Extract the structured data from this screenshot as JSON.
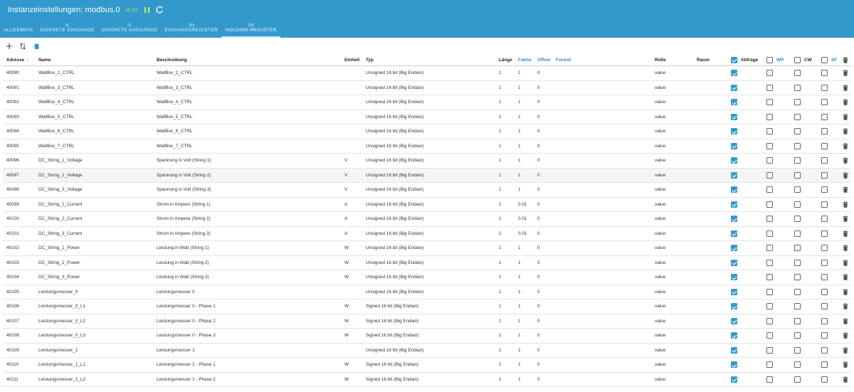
{
  "header": {
    "title": "Instanzeinstellungen: modbus.0",
    "version": "v5.3.5",
    "status_color": "#b6f06a",
    "accent": "#3399cc"
  },
  "tabs": [
    {
      "count": "",
      "label": "ALLGEMEIN",
      "active": false
    },
    {
      "count": "01",
      "label": "DISKRETE EINGÄNGE",
      "active": false
    },
    {
      "count": "01",
      "label": "DISKRETE AUSGÄNGE",
      "active": false
    },
    {
      "count": "193",
      "label": "EINGANGSREGISTER",
      "active": false
    },
    {
      "count": "193",
      "label": "HOLDING-REGISTER",
      "active": true
    }
  ],
  "toolbar": {
    "icons": [
      "plus-icon",
      "sort-icon",
      "import-icon"
    ]
  },
  "columns": {
    "address": "Adresse",
    "name": "Name",
    "description": "Beschreibung",
    "unit": "Einheit",
    "type": "Typ",
    "length": "Länge",
    "factor": "Faktor",
    "offset": "Offset",
    "formula": "Formel",
    "role": "Rolle",
    "room": "Raum",
    "poll": "Abfrage",
    "wp": "WP",
    "cw": "CW",
    "sf": "SF"
  },
  "rows": [
    {
      "address": "40090",
      "name": "WallBox_2_CTRL",
      "description": "WallBox_2_CTRL",
      "unit": "",
      "type": "Unsigned 16 bit (Big Endian)",
      "length": "1",
      "factor": "1",
      "offset": "0",
      "role": "value",
      "poll": true,
      "wp": false,
      "cw": false,
      "sf": false
    },
    {
      "address": "40091",
      "name": "WallBox_3_CTRL",
      "description": "WallBox_3_CTRL",
      "unit": "",
      "type": "Unsigned 16 bit (Big Endian)",
      "length": "1",
      "factor": "1",
      "offset": "0",
      "role": "value",
      "poll": true,
      "wp": false,
      "cw": false,
      "sf": false
    },
    {
      "address": "40092",
      "name": "WallBox_4_CTRL",
      "description": "WallBox_4_CTRL",
      "unit": "",
      "type": "Unsigned 16 bit (Big Endian)",
      "length": "1",
      "factor": "1",
      "offset": "0",
      "role": "value",
      "poll": true,
      "wp": false,
      "cw": false,
      "sf": false
    },
    {
      "address": "40093",
      "name": "WallBox_5_CTRL",
      "description": "WallBox_5_CTRL",
      "unit": "",
      "type": "Unsigned 16 bit (Big Endian)",
      "length": "1",
      "factor": "1",
      "offset": "0",
      "role": "value",
      "poll": true,
      "wp": false,
      "cw": false,
      "sf": false
    },
    {
      "address": "40094",
      "name": "WallBox_6_CTRL",
      "description": "WallBox_6_CTRL",
      "unit": "",
      "type": "Unsigned 16 bit (Big Endian)",
      "length": "1",
      "factor": "1",
      "offset": "0",
      "role": "value",
      "poll": true,
      "wp": false,
      "cw": false,
      "sf": false
    },
    {
      "address": "40095",
      "name": "WallBox_7_CTRL",
      "description": "WallBox_7_CTRL",
      "unit": "",
      "type": "Unsigned 16 bit (Big Endian)",
      "length": "1",
      "factor": "1",
      "offset": "0",
      "role": "value",
      "poll": true,
      "wp": false,
      "cw": false,
      "sf": false
    },
    {
      "address": "40096",
      "name": "DC_String_1_Voltage",
      "description": "Spannung in Volt (String 1)",
      "unit": "V",
      "type": "Unsigned 16 bit (Big Endian)",
      "length": "1",
      "factor": "1",
      "offset": "0",
      "role": "value",
      "poll": true,
      "wp": false,
      "cw": false,
      "sf": false
    },
    {
      "address": "40097",
      "name": "DC_String_2_Voltage",
      "description": "Spannung in Volt (String 2)",
      "unit": "V",
      "type": "Unsigned 16 bit (Big Endian)",
      "length": "1",
      "factor": "1",
      "offset": "0",
      "role": "value",
      "poll": true,
      "wp": false,
      "cw": false,
      "sf": false
    },
    {
      "address": "40098",
      "name": "DC_String_3_Voltage",
      "description": "Spannung in Volt (String 3)",
      "unit": "V",
      "type": "Unsigned 16 bit (Big Endian)",
      "length": "1",
      "factor": "1",
      "offset": "0",
      "role": "value",
      "poll": true,
      "wp": false,
      "cw": false,
      "sf": false
    },
    {
      "address": "40099",
      "name": "DC_String_1_Current",
      "description": "Strom in Ampere (String 1)",
      "unit": "A",
      "type": "Unsigned 16 bit (Big Endian)",
      "length": "1",
      "factor": "0.01",
      "offset": "0",
      "role": "value",
      "poll": true,
      "wp": false,
      "cw": false,
      "sf": false
    },
    {
      "address": "40100",
      "name": "DC_String_2_Current",
      "description": "Strom in Ampere (String 2)",
      "unit": "A",
      "type": "Unsigned 16 bit (Big Endian)",
      "length": "1",
      "factor": "0.01",
      "offset": "0",
      "role": "value",
      "poll": true,
      "wp": false,
      "cw": false,
      "sf": false
    },
    {
      "address": "40101",
      "name": "DC_String_3_Current",
      "description": "Strom in Ampere (String 3)",
      "unit": "A",
      "type": "Unsigned 16 bit (Big Endian)",
      "length": "1",
      "factor": "0.01",
      "offset": "0",
      "role": "value",
      "poll": true,
      "wp": false,
      "cw": false,
      "sf": false
    },
    {
      "address": "40102",
      "name": "DC_String_1_Power",
      "description": "Leistung in Watt (String 1)",
      "unit": "W",
      "type": "Unsigned 16 bit (Big Endian)",
      "length": "1",
      "factor": "1",
      "offset": "0",
      "role": "value",
      "poll": true,
      "wp": false,
      "cw": false,
      "sf": false
    },
    {
      "address": "40103",
      "name": "DC_String_2_Power",
      "description": "Leistung in Watt (String 2)",
      "unit": "W",
      "type": "Unsigned 16 bit (Big Endian)",
      "length": "1",
      "factor": "1",
      "offset": "0",
      "role": "value",
      "poll": true,
      "wp": false,
      "cw": false,
      "sf": false
    },
    {
      "address": "40104",
      "name": "DC_String_3_Power",
      "description": "Leistung in Watt (String 3)",
      "unit": "W",
      "type": "Unsigned 16 bit (Big Endian)",
      "length": "1",
      "factor": "1",
      "offset": "0",
      "role": "value",
      "poll": true,
      "wp": false,
      "cw": false,
      "sf": false
    },
    {
      "address": "40105",
      "name": "Leistungsmesser_0",
      "description": "Leistungsmesser 0",
      "unit": "",
      "type": "Unsigned 16 bit (Big Endian)",
      "length": "1",
      "factor": "1",
      "offset": "0",
      "role": "value",
      "poll": true,
      "wp": false,
      "cw": false,
      "sf": false
    },
    {
      "address": "40106",
      "name": "Leistungsmesser_0_L1",
      "description": "Leistungsmesser 0 - Phase 1",
      "unit": "W",
      "type": "Signed 16 bit (Big Endian)",
      "length": "1",
      "factor": "1",
      "offset": "0",
      "role": "value",
      "poll": true,
      "wp": false,
      "cw": false,
      "sf": false
    },
    {
      "address": "40107",
      "name": "Leistungsmesser_0_L2",
      "description": "Leistungsmesser 0 - Phase 2",
      "unit": "W",
      "type": "Signed 16 bit (Big Endian)",
      "length": "1",
      "factor": "1",
      "offset": "0",
      "role": "value",
      "poll": true,
      "wp": false,
      "cw": false,
      "sf": false
    },
    {
      "address": "40108",
      "name": "Leistungsmesser_0_L3",
      "description": "Leistungsmesser 0 - Phase 3",
      "unit": "W",
      "type": "Signed 16 bit (Big Endian)",
      "length": "1",
      "factor": "1",
      "offset": "0",
      "role": "value",
      "poll": true,
      "wp": false,
      "cw": false,
      "sf": false
    },
    {
      "address": "40109",
      "name": "Leistungsmesser_1",
      "description": "Leistungsmesser 1",
      "unit": "",
      "type": "Unsigned 16 bit (Big Endian)",
      "length": "1",
      "factor": "1",
      "offset": "0",
      "role": "value",
      "poll": true,
      "wp": false,
      "cw": false,
      "sf": false
    },
    {
      "address": "40110",
      "name": "Leistungsmesser_1_L1",
      "description": "Leistungsmesser 1 - Phase 1",
      "unit": "W",
      "type": "Signed 16 bit (Big Endian)",
      "length": "1",
      "factor": "1",
      "offset": "0",
      "role": "value",
      "poll": true,
      "wp": false,
      "cw": false,
      "sf": false
    },
    {
      "address": "40111",
      "name": "Leistungsmesser_1_L2",
      "description": "Leistungsmesser 1 - Phase 2",
      "unit": "W",
      "type": "Signed 16 bit (Big Endian)",
      "length": "1",
      "factor": "1",
      "offset": "0",
      "role": "value",
      "poll": true,
      "wp": false,
      "cw": false,
      "sf": false
    }
  ]
}
